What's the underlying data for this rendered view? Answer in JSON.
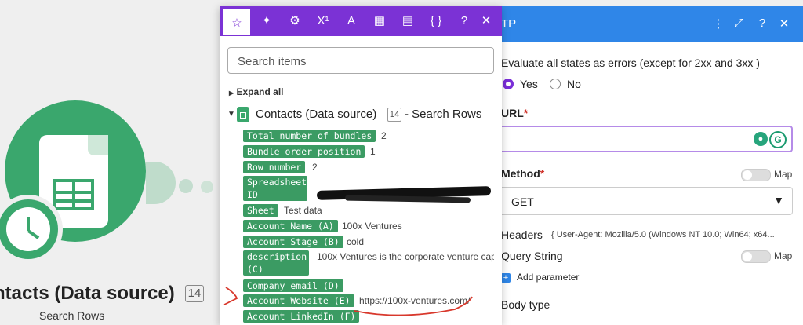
{
  "canvas": {
    "module_title": "ntacts (Data source)",
    "module_badge": "14",
    "module_subtitle": "Search Rows"
  },
  "http_panel": {
    "title": "TP",
    "header_icons": [
      "more-vertical-icon",
      "expand-icon",
      "help-icon",
      "close-icon"
    ],
    "header_glyphs": [
      "⋮",
      "⤢",
      "?",
      "✕"
    ],
    "evaluate_label": "Evaluate all states as errors (except for 2xx and 3xx )",
    "yes_label": "Yes",
    "no_label": "No",
    "selected": "Yes",
    "url_label": "URL",
    "required_mark": "*",
    "url_value": "",
    "method_label": "Method",
    "method_value": "GET",
    "map_label": "Map",
    "headers_label": "Headers",
    "headers_value": "{ User-Agent: Mozilla/5.0 (Windows NT 10.0; Win64; x64...",
    "query_label": "Query String",
    "add_parameter_label": "Add parameter",
    "body_type_label": "Body type",
    "colors": {
      "header": "#2f86e8",
      "accent": "#7a2ed8"
    }
  },
  "popup": {
    "tabs": [
      {
        "icon": "star-icon",
        "glyph": "☆"
      },
      {
        "icon": "sparkle-icon",
        "glyph": "✦"
      },
      {
        "icon": "gear-icon",
        "glyph": "⚙"
      },
      {
        "icon": "superscript-icon",
        "glyph": "X¹"
      },
      {
        "icon": "text-icon",
        "glyph": "A"
      },
      {
        "icon": "calendar-icon",
        "glyph": "▦"
      },
      {
        "icon": "table-icon",
        "glyph": "▤"
      },
      {
        "icon": "braces-icon",
        "glyph": "{ }"
      }
    ],
    "help_glyph": "?",
    "close_glyph": "✕",
    "search_placeholder": "Search items",
    "expand_all_label": "Expand all",
    "tree_title": "Contacts (Data source)",
    "tree_badge": "14",
    "tree_subtitle": "- Search Rows",
    "items": [
      {
        "label": "Total number of bundles",
        "value": "2"
      },
      {
        "label": "Bundle order position",
        "value": "1"
      },
      {
        "label": "Row number",
        "value": "2"
      },
      {
        "label": "Spreadsheet ID",
        "value": ""
      },
      {
        "label": "Sheet",
        "value": "Test data"
      },
      {
        "label": "Account Name (A)",
        "value": "100x Ventures"
      },
      {
        "label": "Account Stage (B)",
        "value": "cold"
      },
      {
        "label": "description (C)",
        "value": "100x Ventures is the corporate venture cap"
      },
      {
        "label": "Company email (D)",
        "value": ""
      },
      {
        "label": "Account Website (E)",
        "value": "https://100x-ventures.com/"
      },
      {
        "label": "Account LinkedIn (F)",
        "value": ""
      }
    ],
    "colors": {
      "tabs": "#7b32d5",
      "pill": "#3b9b63"
    }
  }
}
